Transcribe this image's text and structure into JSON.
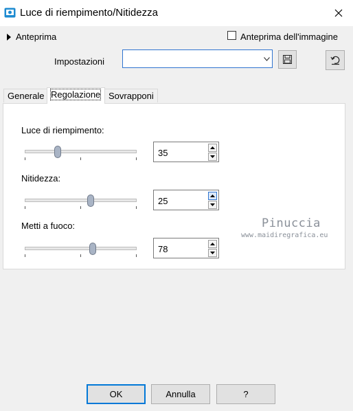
{
  "window": {
    "title": "Luce di riempimento/Nitidezza"
  },
  "preview": {
    "label": "Anteprima",
    "image_preview_label": "Anteprima dell'immagine",
    "image_preview_checked": false
  },
  "settings": {
    "label": "Impostazioni",
    "value": ""
  },
  "tabs": [
    {
      "label": "Generale",
      "active": false
    },
    {
      "label": "Regolazione",
      "active": true
    },
    {
      "label": "Sovrapponi",
      "active": false
    }
  ],
  "sliders": [
    {
      "label": "Luce di riempimento:",
      "value": "35"
    },
    {
      "label": "Nitidezza:",
      "value": "25"
    },
    {
      "label": "Metti a fuoco:",
      "value": "78"
    }
  ],
  "watermark": {
    "name": "Pinuccia",
    "url": "www.maidiregrafica.eu"
  },
  "buttons": {
    "ok": "OK",
    "cancel": "Annulla",
    "help": "?"
  },
  "colors": {
    "accent": "#0078d7",
    "icon": "#1e8bd1"
  },
  "icons": [
    "app-icon",
    "close-icon",
    "expand-arrow-icon",
    "chevron-down-icon",
    "save-icon",
    "reset-icon"
  ]
}
